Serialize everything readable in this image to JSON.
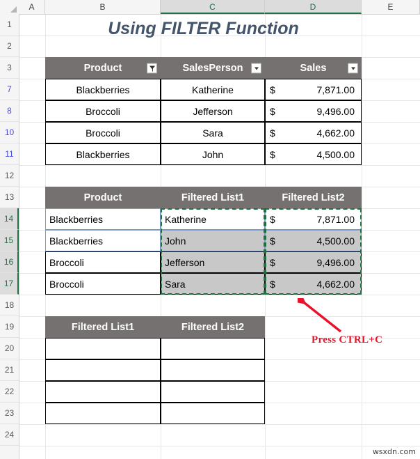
{
  "app": "excel-spreadsheet",
  "grid": {
    "column_headers": [
      {
        "label": "A",
        "selected": false
      },
      {
        "label": "B",
        "selected": false
      },
      {
        "label": "C",
        "selected": true
      },
      {
        "label": "D",
        "selected": true
      },
      {
        "label": "E",
        "selected": false
      }
    ],
    "row_headers": [
      {
        "label": "1",
        "state": "normal"
      },
      {
        "label": "2",
        "state": "normal"
      },
      {
        "label": "3",
        "state": "normal"
      },
      {
        "label": "7",
        "state": "filtered"
      },
      {
        "label": "8",
        "state": "filtered"
      },
      {
        "label": "10",
        "state": "filtered"
      },
      {
        "label": "11",
        "state": "filtered"
      },
      {
        "label": "12",
        "state": "normal"
      },
      {
        "label": "13",
        "state": "normal"
      },
      {
        "label": "14",
        "state": "selected"
      },
      {
        "label": "15",
        "state": "selected"
      },
      {
        "label": "16",
        "state": "selected"
      },
      {
        "label": "17",
        "state": "selected"
      },
      {
        "label": "18",
        "state": "normal"
      },
      {
        "label": "19",
        "state": "normal"
      },
      {
        "label": "20",
        "state": "normal"
      },
      {
        "label": "21",
        "state": "normal"
      },
      {
        "label": "22",
        "state": "normal"
      },
      {
        "label": "23",
        "state": "normal"
      },
      {
        "label": "24",
        "state": "normal"
      }
    ]
  },
  "title": "Using FILTER Function",
  "source_table": {
    "headers": [
      "Product",
      "SalesPerson",
      "Sales"
    ],
    "filter_icons": [
      "funnel-filtered-icon",
      "dropdown-arrow-icon",
      "dropdown-arrow-icon"
    ],
    "rows": [
      {
        "product": "Blackberries",
        "salesperson": "Katherine",
        "currency": "$",
        "sales": "7,871.00"
      },
      {
        "product": "Broccoli",
        "salesperson": "Jefferson",
        "currency": "$",
        "sales": "9,496.00"
      },
      {
        "product": "Broccoli",
        "salesperson": "Sara",
        "currency": "$",
        "sales": "4,662.00"
      },
      {
        "product": "Blackberries",
        "salesperson": "John",
        "currency": "$",
        "sales": "4,500.00"
      }
    ]
  },
  "result_table": {
    "headers": [
      "Product",
      "Filtered List1",
      "Filtered List2"
    ],
    "rows": [
      {
        "product": "Blackberries",
        "list1": "Katherine",
        "currency": "$",
        "list2": "7,871.00"
      },
      {
        "product": "Blackberries",
        "list1": "John",
        "currency": "$",
        "list2": "4,500.00"
      },
      {
        "product": "Broccoli",
        "list1": "Jefferson",
        "currency": "$",
        "list2": "9,496.00"
      },
      {
        "product": "Broccoli",
        "list1": "Sara",
        "currency": "$",
        "list2": "4,662.00"
      }
    ]
  },
  "paste_table": {
    "headers": [
      "Filtered List1",
      "Filtered List2"
    ],
    "rows": [
      {
        "list1": "",
        "list2": ""
      },
      {
        "list1": "",
        "list2": ""
      },
      {
        "list1": "",
        "list2": ""
      },
      {
        "list1": "",
        "list2": ""
      }
    ]
  },
  "annotation": {
    "text": "Press CTRL+C",
    "color": "#e8132b",
    "arrow": "red-arrow-up-left"
  },
  "watermark": "wsxdn.com",
  "colors": {
    "header_fill": "#767171",
    "selection_green": "#1d7040",
    "selected_cell_shade": "#c8c8c8",
    "title_color": "#44546a",
    "filtered_row_header": "#4a4ad6"
  }
}
